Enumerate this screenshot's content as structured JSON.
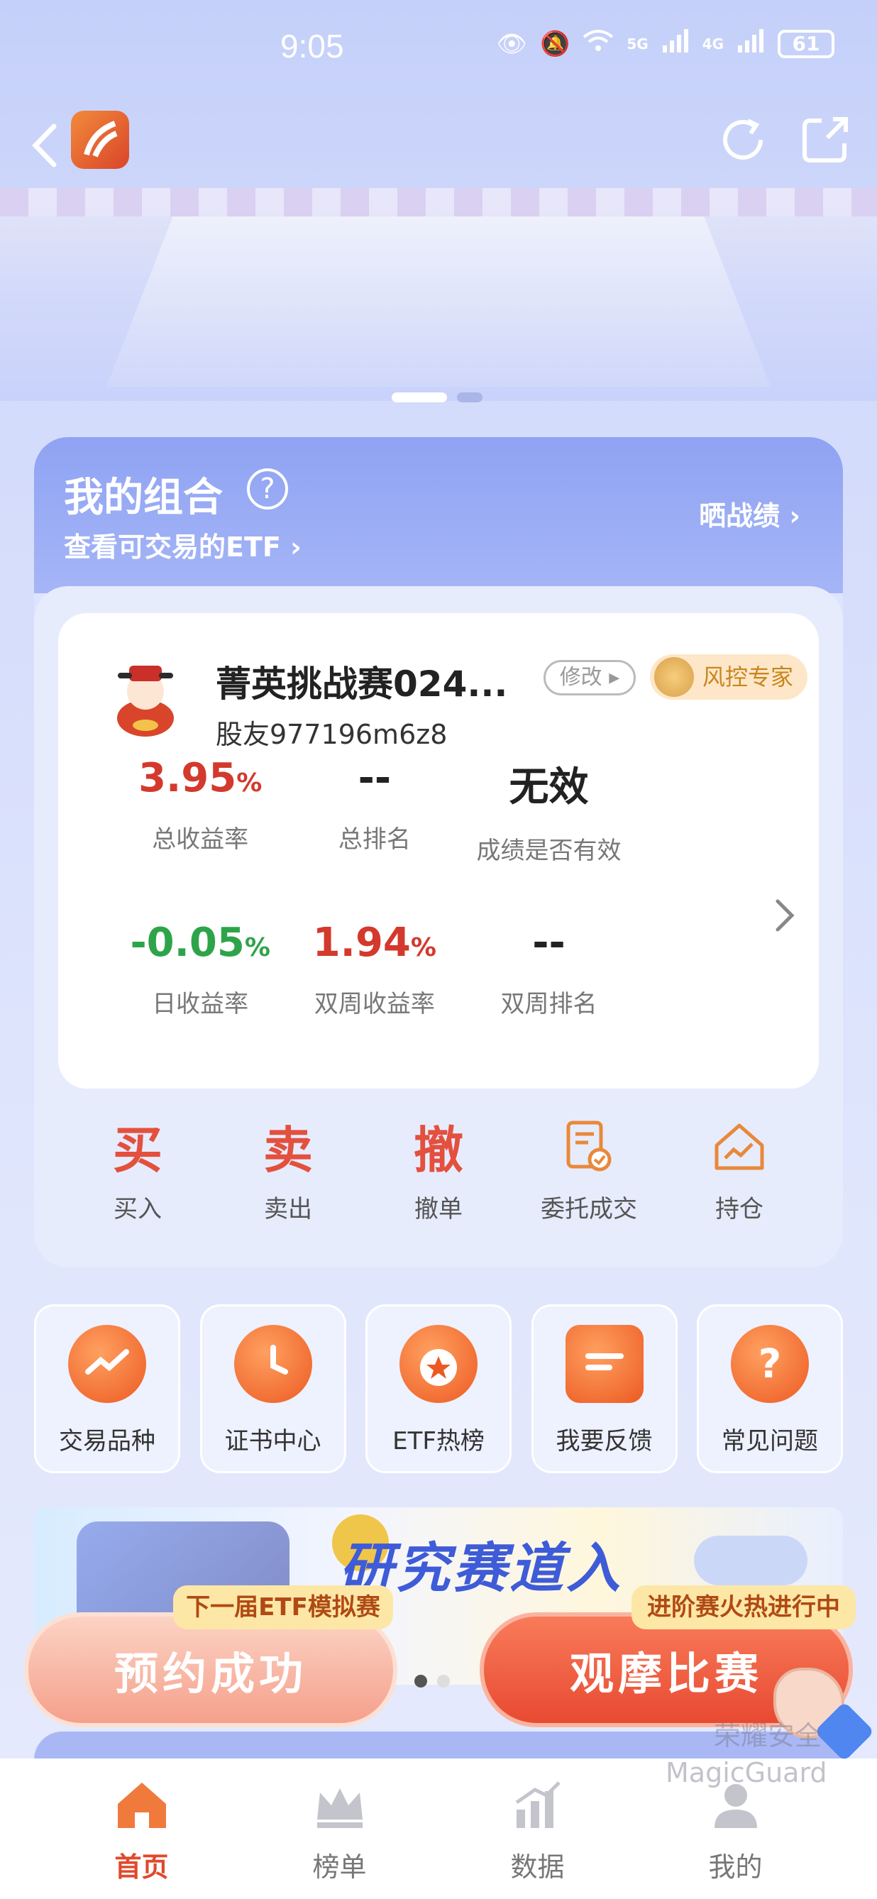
{
  "status_bar": {
    "time": "9:05",
    "network_5g": "5G",
    "network_4g": "4G",
    "battery": "61"
  },
  "hero": {
    "carousel_active_index": 0,
    "carousel_count": 2
  },
  "portfolio": {
    "title": "我的组合",
    "help_icon": "?",
    "subtitle": "查看可交易的ETF",
    "share_link": "晒战绩",
    "card": {
      "name": "菁英挑战赛024...",
      "edit_label": "修改",
      "badge": "风控专家",
      "user": "股友977196m6z8",
      "stats": [
        {
          "value": "3.95",
          "unit": "%",
          "label": "总收益率",
          "color": "#d3392c"
        },
        {
          "value": "--",
          "unit": "",
          "label": "总排名",
          "color": "#222222"
        },
        {
          "value": "无效",
          "unit": "",
          "label": "成绩是否有效",
          "color": "#222222"
        },
        {
          "value": "-0.05",
          "unit": "%",
          "label": "日收益率",
          "color": "#2ea44a"
        },
        {
          "value": "1.94",
          "unit": "%",
          "label": "双周收益率",
          "color": "#d3392c"
        },
        {
          "value": "--",
          "unit": "",
          "label": "双周排名",
          "color": "#222222"
        }
      ]
    },
    "actions": [
      {
        "glyph": "买",
        "label": "买入"
      },
      {
        "glyph": "卖",
        "label": "卖出"
      },
      {
        "glyph": "撤",
        "label": "撤单"
      },
      {
        "glyph": "",
        "label": "委托成交",
        "icon": "document-check-icon"
      },
      {
        "glyph": "",
        "label": "持仓",
        "icon": "house-chart-icon"
      }
    ]
  },
  "quick_nav": [
    {
      "label": "交易品种",
      "icon": "trend-magnifier-icon"
    },
    {
      "label": "证书中心",
      "icon": "clock-icon"
    },
    {
      "label": "ETF热榜",
      "icon": "medal-star-icon"
    },
    {
      "label": "我要反馈",
      "icon": "feedback-message-icon"
    },
    {
      "label": "常见问题",
      "icon": "question-bubble-icon"
    }
  ],
  "promo": {
    "headline": "研究赛道入"
  },
  "cta": {
    "left_tag": "下一届ETF模拟赛",
    "left_label": "预约成功",
    "right_tag": "进阶赛火热进行中",
    "right_label": "观摩比赛"
  },
  "watermark": {
    "line1": "荣耀安全",
    "line2": "MagicGuard"
  },
  "bottom_nav": [
    {
      "label": "首页",
      "active": true,
      "icon": "home-icon"
    },
    {
      "label": "榜单",
      "active": false,
      "icon": "crown-icon"
    },
    {
      "label": "数据",
      "active": false,
      "icon": "bar-chart-icon"
    },
    {
      "label": "我的",
      "active": false,
      "icon": "user-icon"
    }
  ],
  "colors": {
    "accent": "#e04a2c",
    "positive": "#d3392c",
    "negative": "#2ea44a",
    "panel_header": "#8fa3f3"
  }
}
